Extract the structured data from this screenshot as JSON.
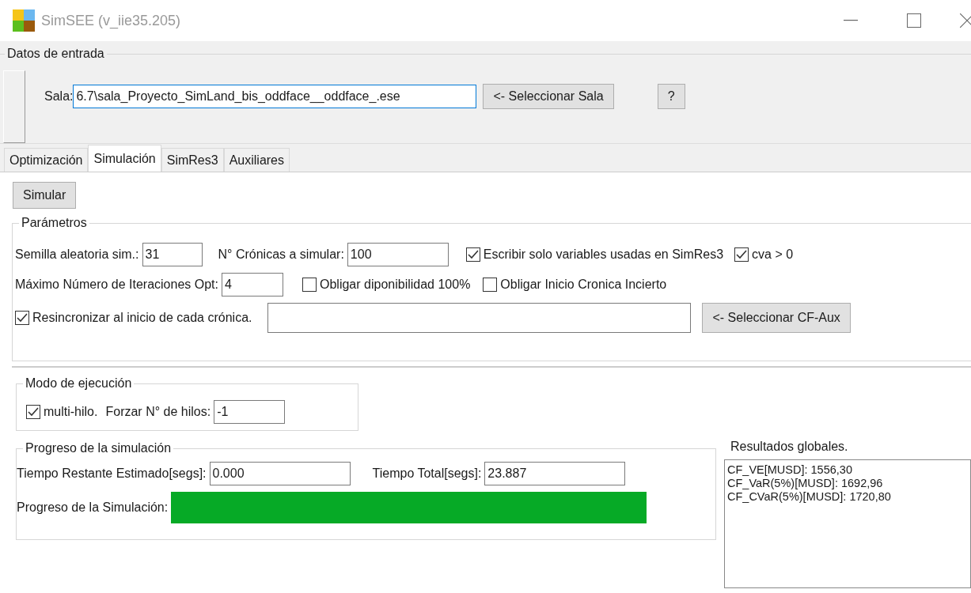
{
  "window": {
    "title": "SimSEE (v_iie35.205)"
  },
  "input_data": {
    "legend": "Datos de entrada",
    "sala_label": "Sala:",
    "sala_value": "6.7\\sala_Proyecto_SimLand_bis_oddface__oddface_.ese",
    "select_button": "<- Seleccionar Sala",
    "help_button": "?"
  },
  "tabs": [
    {
      "label": "Optimización",
      "selected": false
    },
    {
      "label": "Simulación",
      "selected": true
    },
    {
      "label": "SimRes3",
      "selected": false
    },
    {
      "label": "Auxiliares",
      "selected": false
    }
  ],
  "simulate_button": "Simular",
  "parameters": {
    "legend": "Parámetros",
    "seed": {
      "label": "Semilla aleatoria sim.:",
      "value": "31"
    },
    "chronicles": {
      "label": "N° Crónicas a simular:",
      "value": "100"
    },
    "write_only_used": {
      "label": "Escribir solo variables usadas en SimRes3",
      "checked": true
    },
    "cva": {
      "label": "cva > 0",
      "checked": true
    },
    "max_iterations": {
      "label": "Máximo Número de Iteraciones Opt:",
      "value": "4"
    },
    "force_availability": {
      "label": "Obligar diponibilidad 100%",
      "checked": false
    },
    "force_uncertain_start": {
      "label": "Obligar Inicio Cronica Incierto",
      "checked": false
    },
    "resync": {
      "label": "Resincronizar al inicio de cada crónica.",
      "checked": true
    },
    "cf_aux_button": "<- Seleccionar CF-Aux"
  },
  "execution_mode": {
    "legend": "Modo de ejecución",
    "multithread": {
      "label": "multi-hilo.",
      "checked": true
    },
    "threads": {
      "label": "Forzar N° de hilos:",
      "value": "-1"
    }
  },
  "progress": {
    "legend": "Progreso de la simulación",
    "remaining": {
      "label": "Tiempo Restante Estimado[segs]:",
      "value": "0.000"
    },
    "total": {
      "label": "Tiempo Total[segs]:",
      "value": "23.887"
    },
    "bar_label": "Progreso de la Simulación:",
    "level": 1
  },
  "results": {
    "legend": "Resultados globales.",
    "lines": [
      "CF_VE[MUSD]: 1556,30",
      "CF_VaR(5%)[MUSD]: 1692,96",
      "CF_CVaR(5%)[MUSD]: 1720,80"
    ]
  }
}
